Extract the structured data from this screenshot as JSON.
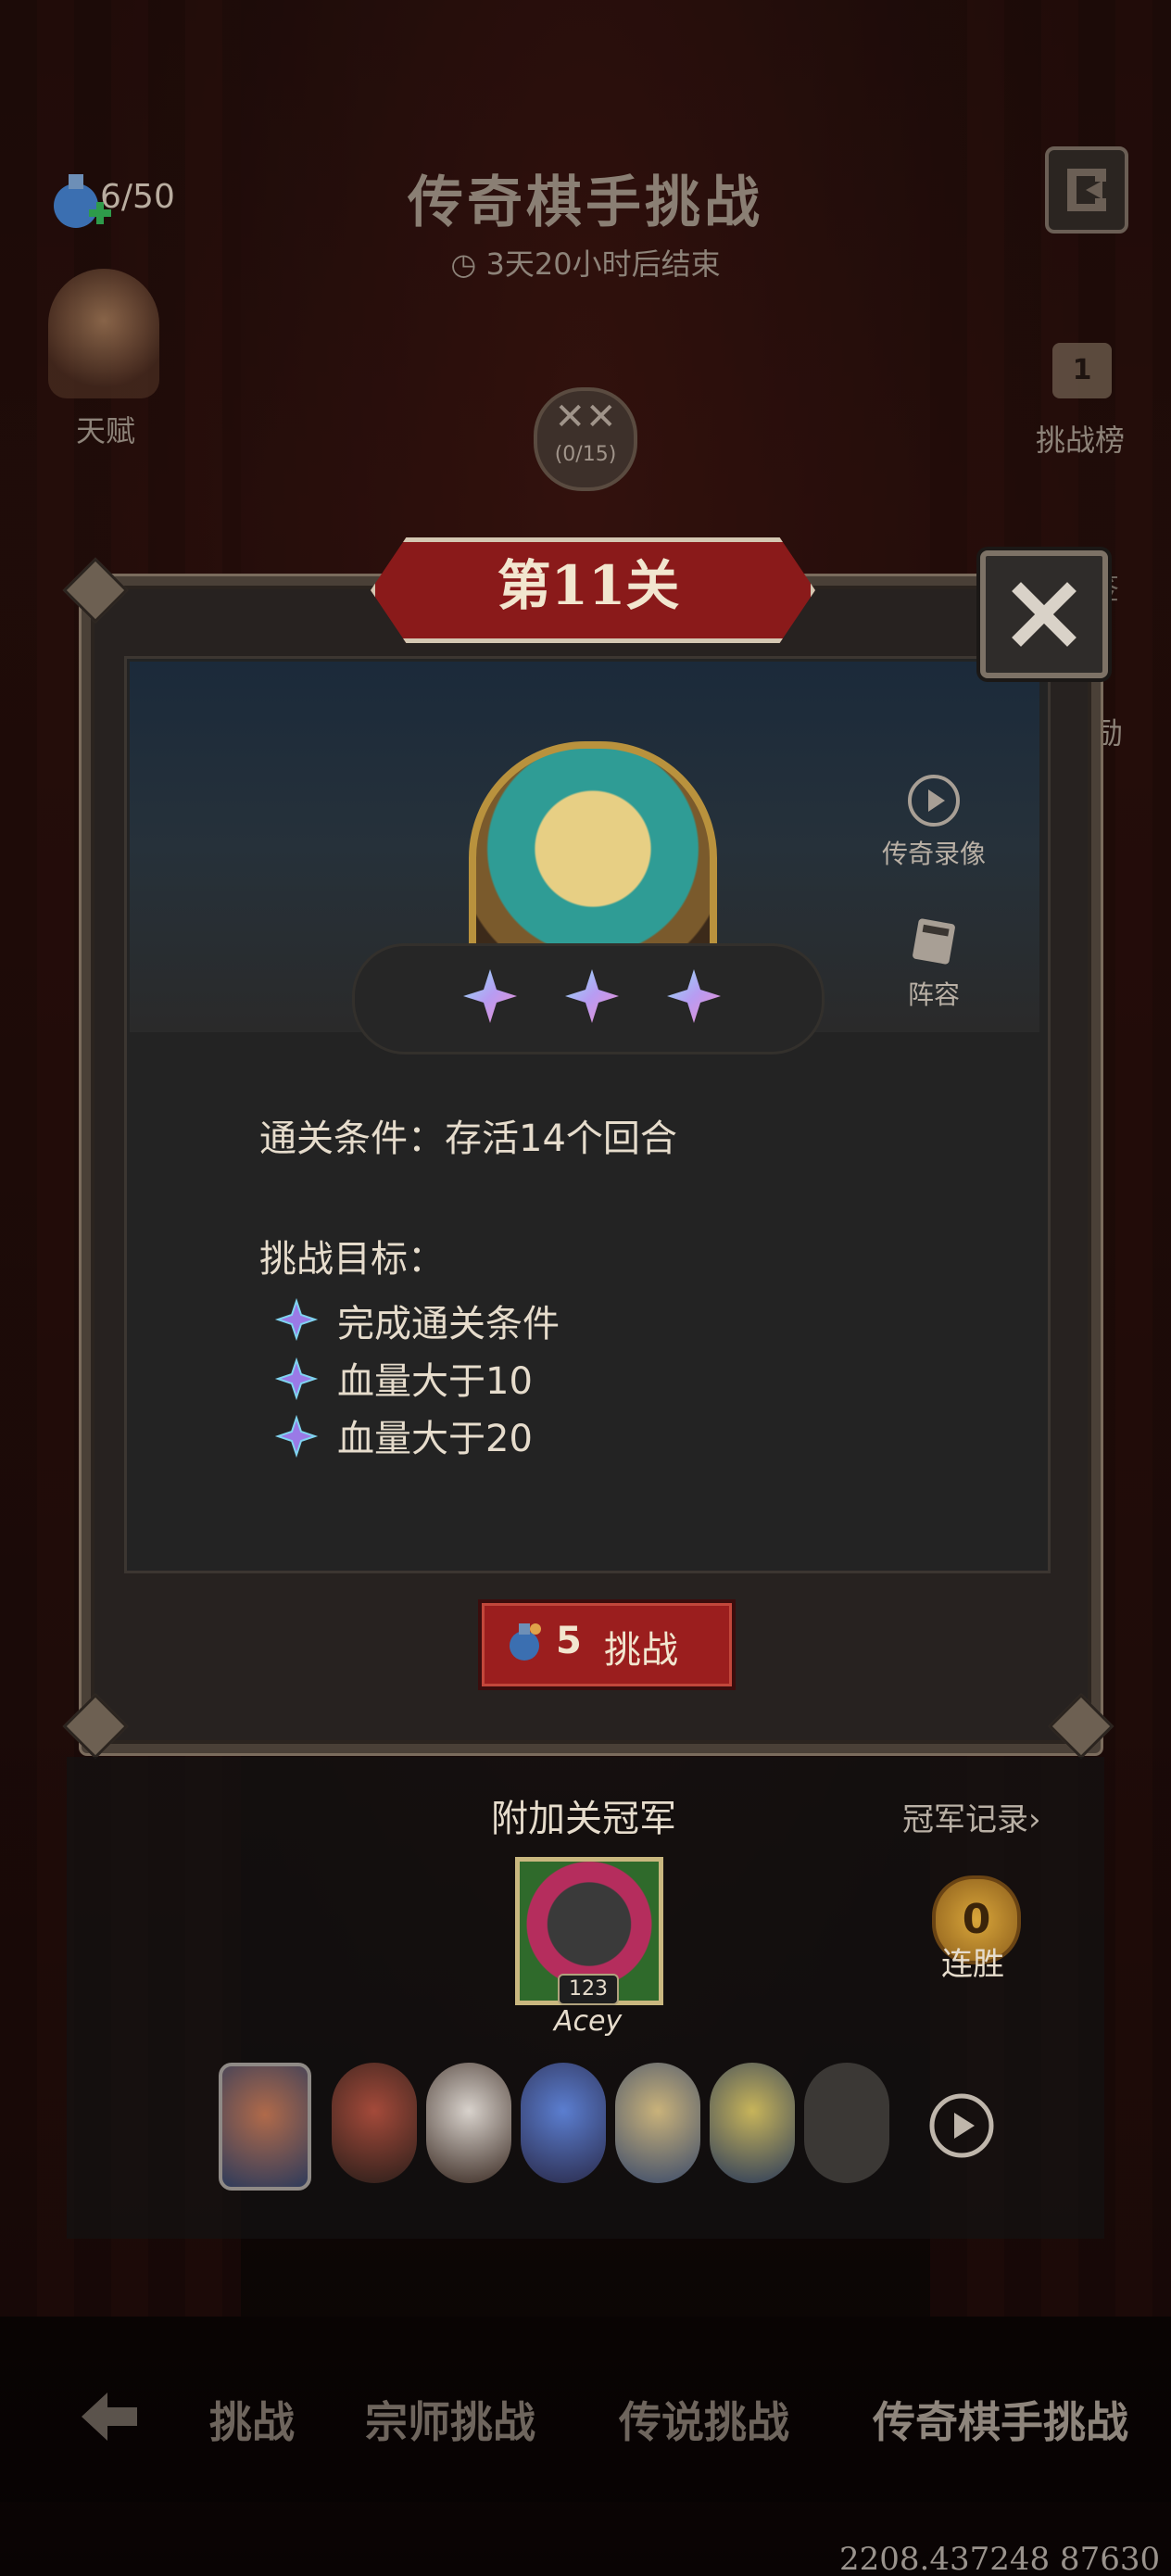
{
  "hud": {
    "potion_count": "6/50",
    "event_title": "传奇棋手挑战",
    "event_time": "3天20小时后结束",
    "talent_label": "天赋",
    "rank_number": "1",
    "rank_label": "挑战榜",
    "sign_label": "签",
    "reward_label": "奖励",
    "sword_progress": "(0/15)"
  },
  "modal": {
    "stage_title": "第11关",
    "replay_label": "传奇录像",
    "lineup_label": "阵容",
    "stars_earned": 3,
    "condition": "通关条件：存活14个回合",
    "goals_heading": "挑战目标：",
    "goals": [
      "完成通关条件",
      "血量大于10",
      "血量大于20"
    ],
    "challenge_cost": "5",
    "challenge_label": "挑战"
  },
  "champion": {
    "title": "附加关冠军",
    "record_link": "冠军记录›",
    "level": "123",
    "name": "Acey",
    "streak_count": "0",
    "streak_label": "连胜"
  },
  "tabs": [
    "挑战",
    "宗师挑战",
    "传说挑战",
    "传奇棋手挑战"
  ],
  "coords": "2208.437248 87630",
  "colors": {
    "banner_red": "#8a1a1a",
    "button_red": "#9b1e1e",
    "panel_bg": "#272220",
    "star_gradient": "#7ec8f0"
  }
}
